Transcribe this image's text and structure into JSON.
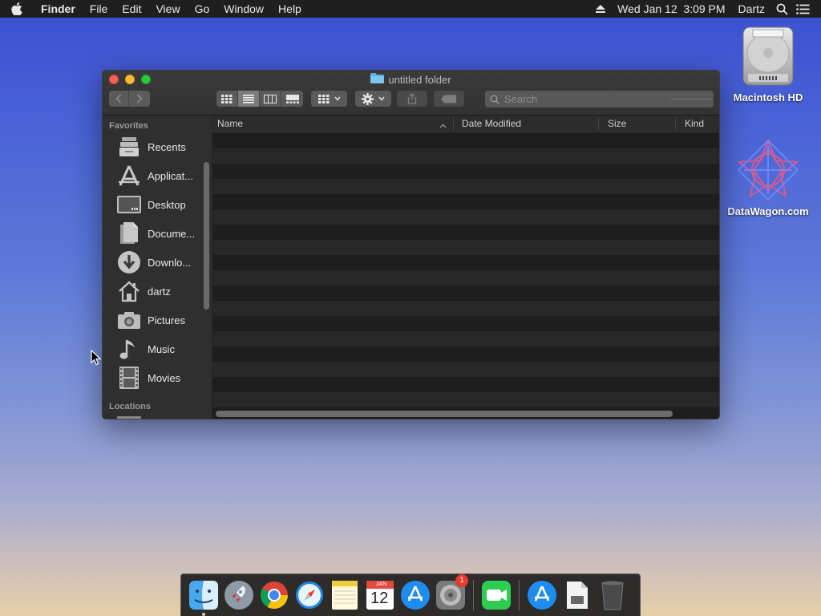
{
  "menubar": {
    "app_name": "Finder",
    "items": [
      "File",
      "Edit",
      "View",
      "Go",
      "Window",
      "Help"
    ],
    "datetime": "Wed Jan 12  3:09 PM",
    "user": "Dartz",
    "icons": [
      "apple-icon",
      "eject-icon",
      "spotlight-search-icon",
      "notification-center-icon"
    ]
  },
  "desktop": {
    "icons": [
      {
        "label": "Macintosh HD",
        "icon": "hard-drive-icon"
      },
      {
        "label": "DataWagon.com",
        "icon": "datawagon-logo-icon"
      }
    ]
  },
  "window": {
    "title": "untitled folder",
    "search_placeholder": "Search",
    "toolbar": {
      "views": [
        "icon-view",
        "list-view",
        "column-view",
        "gallery-view"
      ],
      "selected_view": "list-view"
    },
    "sidebar": {
      "favorites_label": "Favorites",
      "favorites": [
        {
          "label": "Recents",
          "icon": "recents-icon"
        },
        {
          "label": "Applicat...",
          "icon": "applications-icon"
        },
        {
          "label": "Desktop",
          "icon": "desktop-icon"
        },
        {
          "label": "Docume...",
          "icon": "documents-icon"
        },
        {
          "label": "Downlo...",
          "icon": "downloads-icon"
        },
        {
          "label": "dartz",
          "icon": "home-icon"
        },
        {
          "label": "Pictures",
          "icon": "pictures-icon"
        },
        {
          "label": "Music",
          "icon": "music-icon"
        },
        {
          "label": "Movies",
          "icon": "movies-icon"
        }
      ],
      "locations_label": "Locations"
    },
    "columns": {
      "name": "Name",
      "date_modified": "Date Modified",
      "size": "Size",
      "kind": "Kind"
    },
    "rows": []
  },
  "dock": {
    "apps": [
      "Finder",
      "Launchpad",
      "Google Chrome",
      "Safari",
      "Notes",
      "Calendar",
      "App Store",
      "System Preferences",
      "FaceTime",
      "App Store Downloads",
      "Document",
      "Trash"
    ],
    "calendar": {
      "month": "JAN",
      "day": "12"
    },
    "system_prefs_badge": "1"
  }
}
